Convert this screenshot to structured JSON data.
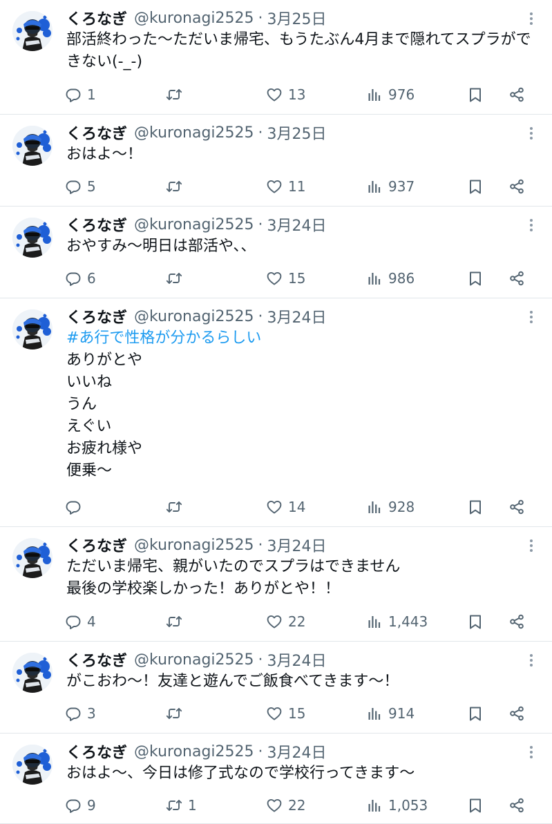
{
  "colors": {
    "accent": "#1d9bf0",
    "text_primary": "#0f1419",
    "text_secondary": "#536471",
    "divider": "#e1e6ea"
  },
  "icons": [
    "more-icon",
    "reply-icon",
    "retweet-icon",
    "like-icon",
    "views-icon",
    "bookmark-icon",
    "share-icon"
  ],
  "tweets": [
    {
      "name": "くろなぎ",
      "handle": "@kuronagi2525",
      "dot": "·",
      "date": "3月25日",
      "tag": "",
      "text": "部活終わった〜ただいま帰宅、もうたぶん4月まで隠れてスプラができない(-_-)",
      "replies": "1",
      "retweets": "",
      "likes": "13",
      "views": "976"
    },
    {
      "name": "くろなぎ",
      "handle": "@kuronagi2525",
      "dot": "·",
      "date": "3月25日",
      "tag": "",
      "text": "おはよ〜！",
      "replies": "5",
      "retweets": "",
      "likes": "11",
      "views": "937"
    },
    {
      "name": "くろなぎ",
      "handle": "@kuronagi2525",
      "dot": "·",
      "date": "3月24日",
      "tag": "",
      "text": "おやすみ〜明日は部活や、、",
      "replies": "6",
      "retweets": "",
      "likes": "15",
      "views": "986"
    },
    {
      "name": "くろなぎ",
      "handle": "@kuronagi2525",
      "dot": "·",
      "date": "3月24日",
      "tag": "#あ行で性格が分かるらしい",
      "text": "ありがとや\nいいね\nうん\nえぐい\nお疲れ様や\n便乗〜",
      "replies": "",
      "retweets": "",
      "likes": "14",
      "views": "928"
    },
    {
      "name": "くろなぎ",
      "handle": "@kuronagi2525",
      "dot": "·",
      "date": "3月24日",
      "tag": "",
      "text": "ただいま帰宅、親がいたのでスプラはできません\n最後の学校楽しかった！ありがとや！！",
      "replies": "4",
      "retweets": "",
      "likes": "22",
      "views": "1,443"
    },
    {
      "name": "くろなぎ",
      "handle": "@kuronagi2525",
      "dot": "·",
      "date": "3月24日",
      "tag": "",
      "text": "がこおわ〜！友達と遊んでご飯食べてきます〜！",
      "replies": "3",
      "retweets": "",
      "likes": "15",
      "views": "914"
    },
    {
      "name": "くろなぎ",
      "handle": "@kuronagi2525",
      "dot": "·",
      "date": "3月24日",
      "tag": "",
      "text": "おはよ〜、今日は修了式なので学校行ってきます〜",
      "replies": "9",
      "retweets": "1",
      "likes": "22",
      "views": "1,053"
    }
  ]
}
